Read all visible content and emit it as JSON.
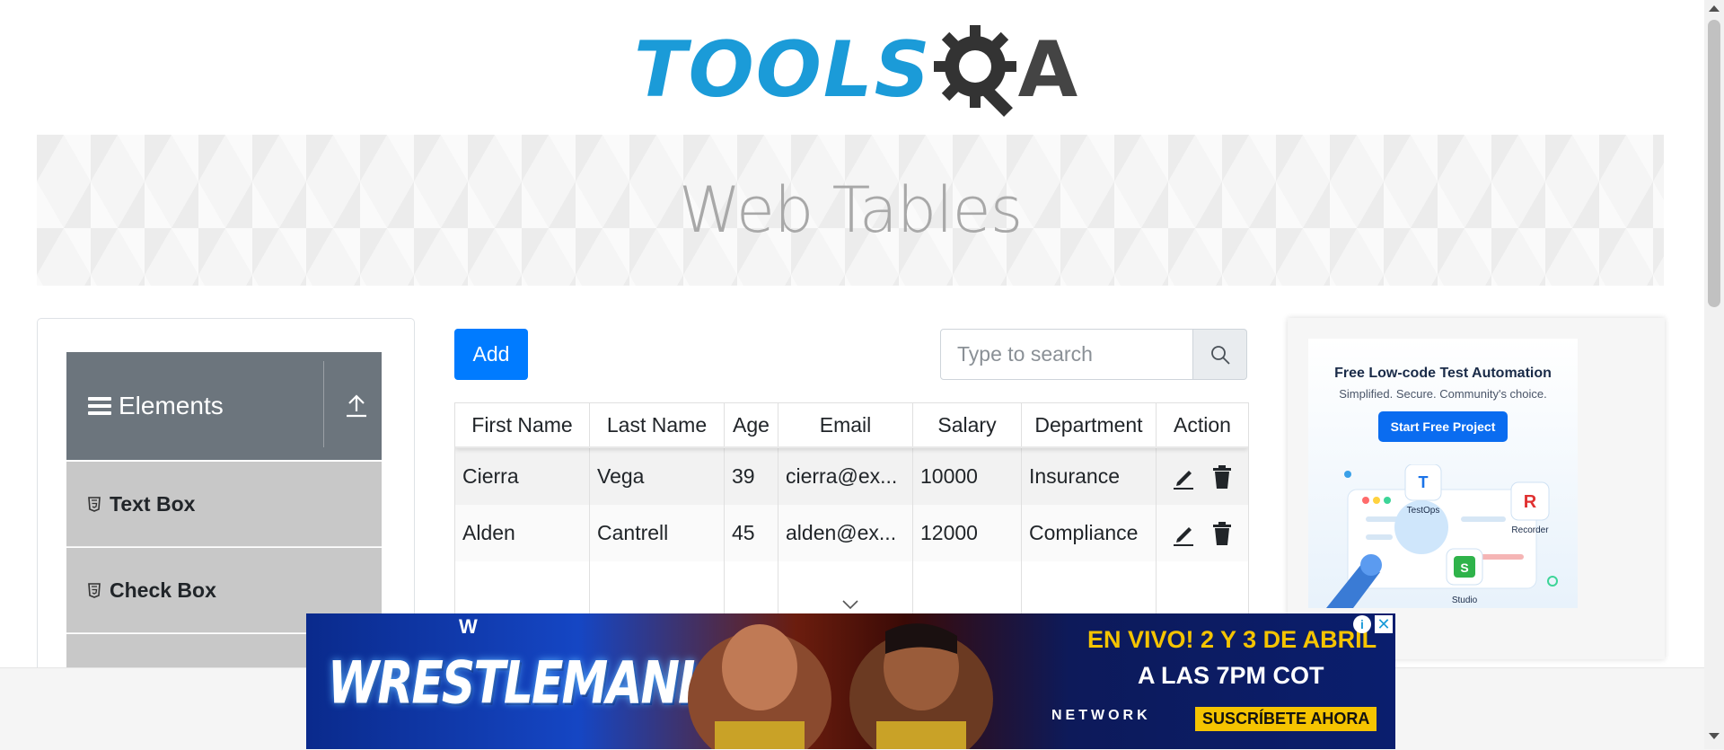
{
  "logo": {
    "tools": "TOOLS",
    "a": "A"
  },
  "banner": {
    "title": "Web Tables"
  },
  "sidebar": {
    "group_title": "Elements",
    "items": [
      {
        "label": "Text Box"
      },
      {
        "label": "Check Box"
      },
      {
        "label": ""
      }
    ]
  },
  "toolbar": {
    "add_label": "Add",
    "search_placeholder": "Type to search"
  },
  "table": {
    "headers": [
      "First Name",
      "Last Name",
      "Age",
      "Email",
      "Salary",
      "Department",
      "Action"
    ],
    "rows": [
      {
        "first": "Cierra",
        "last": "Vega",
        "age": "39",
        "email": "cierra@ex...",
        "salary": "10000",
        "department": "Insurance"
      },
      {
        "first": "Alden",
        "last": "Cantrell",
        "age": "45",
        "email": "alden@ex...",
        "salary": "12000",
        "department": "Compliance"
      }
    ]
  },
  "right_ad": {
    "headline": "Free Low-code Test Automation",
    "sub": "Simplified. Secure. Community's choice.",
    "cta": "Start Free Project",
    "labels": {
      "testops": "TestOps",
      "recorder": "Recorder",
      "studio": "Studio"
    }
  },
  "bottom_ad": {
    "title": "WRESTLEMANIA",
    "line1_a": "EN VIVO! ",
    "line1_b": "2 Y 3 DE ABRIL",
    "line2": "A LAS 7PM COT",
    "network": "NETWORK",
    "cta": "SUSCRÍBETE AHORA",
    "info": "i",
    "close": "✕"
  },
  "colors": {
    "primary": "#007bff",
    "sidebar_header": "#6c757d",
    "sidebar_item": "#c8c8c8",
    "logo_blue": "#1b9bd8"
  }
}
